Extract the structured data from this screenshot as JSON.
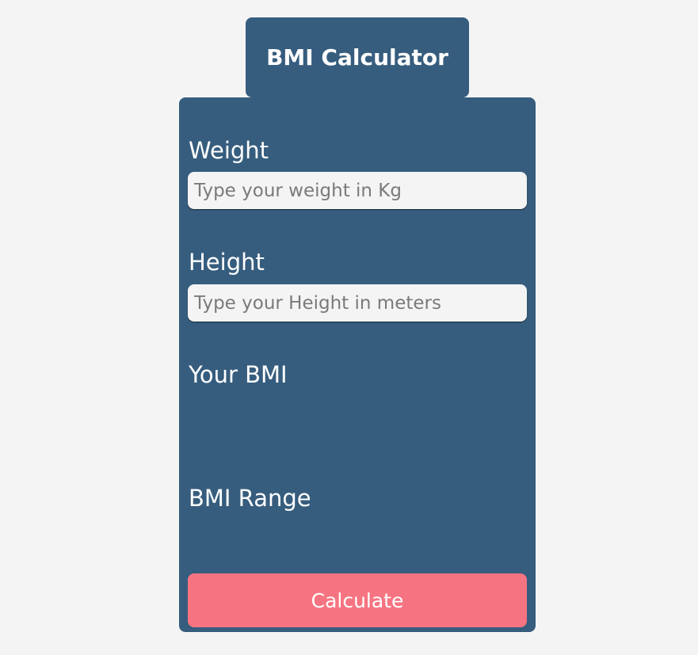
{
  "header": {
    "title": "BMI Calculator"
  },
  "form": {
    "weight_label": "Weight",
    "weight_placeholder": "Type your weight in Kg",
    "weight_value": "",
    "height_label": "Height",
    "height_placeholder": "Type your Height in meters",
    "height_value": "",
    "bmi_label": "Your BMI",
    "bmi_value": "",
    "range_label": "BMI Range",
    "range_value": "",
    "calculate_label": "Calculate"
  },
  "colors": {
    "page_background": "#f4f4f4",
    "panel_background": "#365d7e",
    "button_background": "#f67481",
    "text": "#ffffff"
  }
}
